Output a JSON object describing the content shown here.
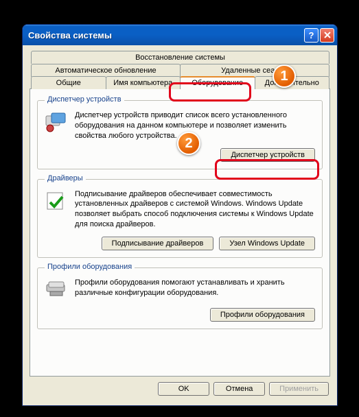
{
  "window": {
    "title": "Свойства системы"
  },
  "tabs_row1": [
    {
      "label": "Восстановление системы"
    },
    {
      "label": "Автоматическое обновление"
    },
    {
      "label": "Удаленные сеансы"
    }
  ],
  "tabs_row2": [
    {
      "label": "Общие"
    },
    {
      "label": "Имя компьютера"
    },
    {
      "label": "Оборудование"
    },
    {
      "label": "Дополнительно"
    }
  ],
  "active_tab": "Оборудование",
  "groups": {
    "device_manager": {
      "title": "Диспетчер устройств",
      "text": "Диспетчер устройств приводит список всего установленного оборудования на данном компьютере и позволяет изменить свойства любого устройства.",
      "button": "Диспетчер устройств"
    },
    "drivers": {
      "title": "Драйверы",
      "text": "Подписывание драйверов обеспечивает совместимость установленных драйверов с системой Windows.  Windows Update позволяет выбрать способ подключения системы к Windows Update для поиска драйверов.",
      "button1": "Подписывание драйверов",
      "button2": "Узел Windows Update"
    },
    "hw_profiles": {
      "title": "Профили оборудования",
      "text": "Профили оборудования помогают устанавливать и хранить различные конфигурации оборудования.",
      "button": "Профили оборудования"
    }
  },
  "dialog_buttons": {
    "ok": "OK",
    "cancel": "Отмена",
    "apply": "Применить"
  },
  "annotations": {
    "badge1": "1",
    "badge2": "2"
  }
}
